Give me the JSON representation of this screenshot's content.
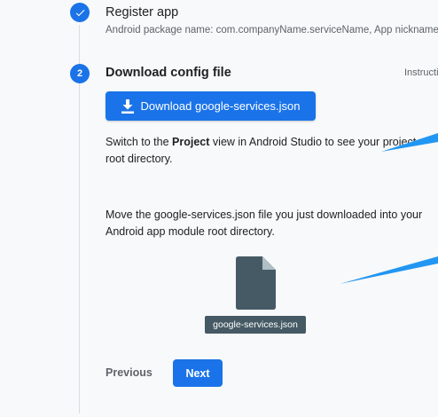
{
  "steps": [
    {
      "number": "",
      "title": "Register app",
      "subtitle": "Android package name: com.companyName.serviceName, App nickname",
      "state": "done"
    },
    {
      "number": "2",
      "title": "Download config file",
      "state": "active"
    }
  ],
  "instructions_label": "Instructions",
  "download_button": {
    "label": "Download google-services.json",
    "icon": "download-icon"
  },
  "paragraph1": {
    "before": "Switch to the ",
    "bold": "Project",
    "after": " view in Android Studio to see your project root directory."
  },
  "paragraph2": "Move the google-services.json file you just downloaded into your Android app module root directory.",
  "file": {
    "name": "google-services.json",
    "icon": "file-icon"
  },
  "nav": {
    "previous": "Previous",
    "next": "Next"
  },
  "colors": {
    "primary": "#1a73e8",
    "file": "#455a64",
    "background": "#f8f9fa"
  }
}
